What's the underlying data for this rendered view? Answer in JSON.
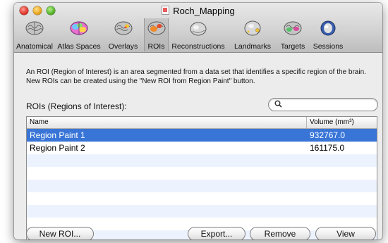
{
  "window": {
    "title": "Roch_Mapping"
  },
  "toolbar": {
    "selected_index": 3,
    "items": [
      {
        "label": "Anatomical",
        "icon": "anatomical-brain-icon"
      },
      {
        "label": "Atlas Spaces",
        "icon": "atlas-spaces-brain-icon"
      },
      {
        "label": "Overlays",
        "icon": "overlays-brain-icon"
      },
      {
        "label": "ROIs",
        "icon": "rois-brain-icon"
      },
      {
        "label": "Reconstructions",
        "icon": "reconstruction-head-icon"
      },
      {
        "label": "Landmarks",
        "icon": "landmarks-head-icon"
      },
      {
        "label": "Targets",
        "icon": "targets-brain-icon"
      },
      {
        "label": "Sessions",
        "icon": "sessions-head-icon"
      }
    ]
  },
  "roi_panel": {
    "description": "An ROI (Region of Interest) is an area segmented from a data set that identifies a specific region of the brain. New ROIs can be created using the \"New ROI from Region Paint\" button.",
    "section_label": "ROIs (Regions of Interest):",
    "search": {
      "value": "",
      "placeholder": ""
    },
    "table": {
      "columns": [
        "Name",
        "Volume (mm³)"
      ],
      "rows": [
        {
          "name": "Region Paint 1",
          "volume": "932767.0",
          "selected": true
        },
        {
          "name": "Region Paint 2",
          "volume": "161175.0",
          "selected": false
        }
      ]
    },
    "buttons": {
      "new_roi": "New ROI...",
      "export": "Export...",
      "remove": "Remove",
      "view": "View"
    }
  },
  "colors": {
    "selection": "#3875d7",
    "alternate_row": "#edf3fe"
  }
}
